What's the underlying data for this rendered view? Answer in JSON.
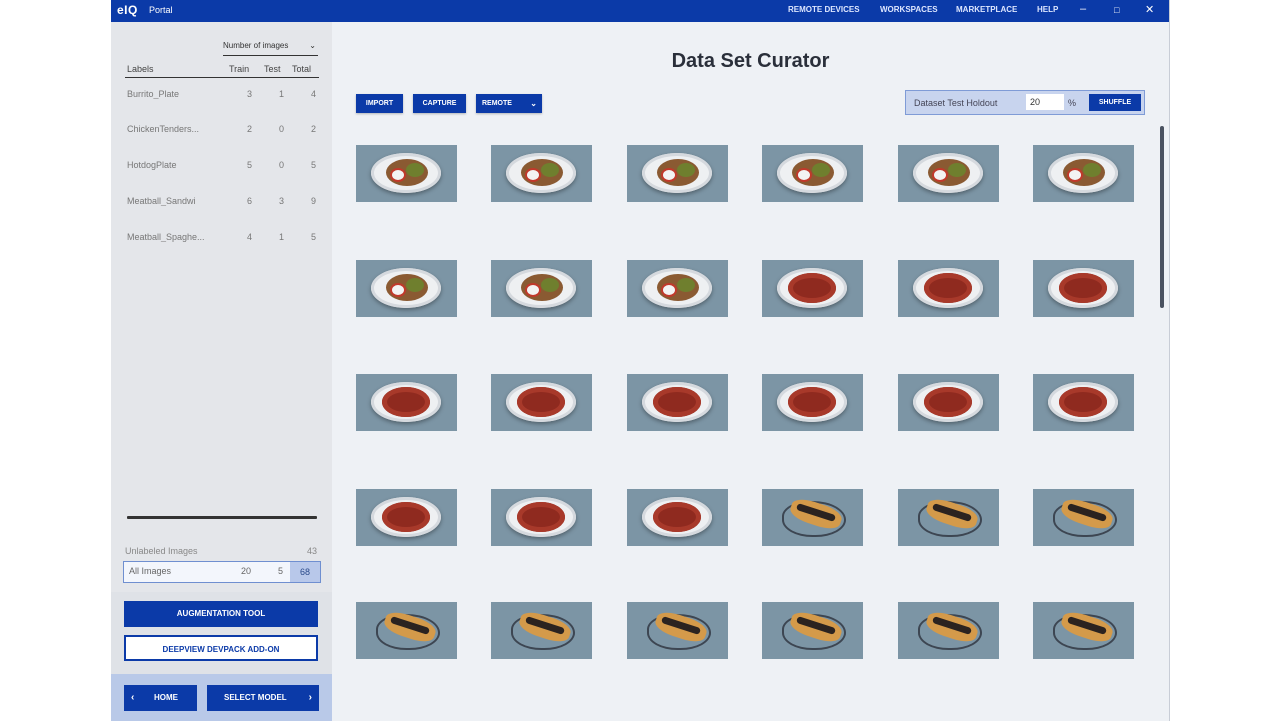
{
  "app": {
    "logo": "eIQ",
    "title": "Portal",
    "nav": [
      "REMOTE DEVICES",
      "WORKSPACES",
      "MARKETPLACE",
      "HELP"
    ],
    "window_controls": [
      "–",
      "□",
      "✕"
    ]
  },
  "sidebar": {
    "sort_select": "Number of images",
    "columns": {
      "labels": "Labels",
      "train": "Train",
      "test": "Test",
      "total": "Total"
    },
    "rows": [
      {
        "name": "Burrito_Plate",
        "train": "3",
        "test": "1",
        "total": "4"
      },
      {
        "name": "ChickenTenders...",
        "train": "2",
        "test": "0",
        "total": "2"
      },
      {
        "name": "HotdogPlate",
        "train": "5",
        "test": "0",
        "total": "5"
      },
      {
        "name": "Meatball_Sandwi",
        "train": "6",
        "test": "3",
        "total": "9"
      },
      {
        "name": "Meatball_Spaghe...",
        "train": "4",
        "test": "1",
        "total": "5"
      }
    ],
    "unlabeled": {
      "label": "Unlabeled Images",
      "value": "43"
    },
    "all_images": {
      "label": "All Images",
      "train": "20",
      "test": "5",
      "total": "68"
    },
    "augmentation_button": "AUGMENTATION TOOL",
    "deploy_button": "DEEPVIEW DEVPACK ADD-ON",
    "home_button": "HOME",
    "select_model_button": "SELECT MODEL"
  },
  "main": {
    "title": "Data Set Curator",
    "toolbar": {
      "import": "IMPORT",
      "capture": "CAPTURE",
      "remote": "REMOTE"
    },
    "holdout": {
      "label": "Dataset Test Holdout",
      "value": "20",
      "unit": "%",
      "shuffle": "SHUFFLE"
    }
  },
  "colors": {
    "brand": "#0b3aa8",
    "sidebar": "#e4e6ea",
    "canvas": "#eef1f5"
  },
  "icons": [
    "chevron-down-icon",
    "chevron-left-icon",
    "chevron-right-icon",
    "minimize-icon",
    "maximize-icon",
    "close-icon"
  ],
  "thumbnails": [
    "plated",
    "plated",
    "plated",
    "plated",
    "plated",
    "plated",
    "plated",
    "plated",
    "plated",
    "pasta",
    "pasta",
    "pasta",
    "pasta",
    "pasta",
    "pasta",
    "pasta",
    "pasta",
    "pasta",
    "pasta",
    "pasta",
    "pasta",
    "hotdog",
    "hotdog",
    "hotdog",
    "hotdog",
    "hotdog",
    "hotdog",
    "hotdog",
    "hotdog",
    "hotdog"
  ]
}
